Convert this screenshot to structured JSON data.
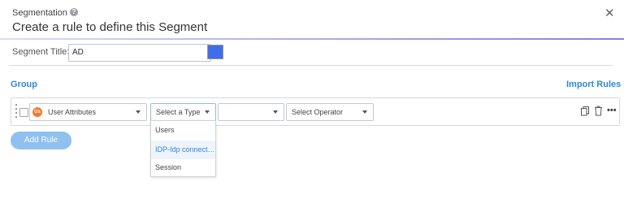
{
  "header": {
    "subtitle": "Segmentation",
    "title": "Create a rule to define this Segment",
    "close_glyph": "✕"
  },
  "segment": {
    "title_label": "Segment Title:",
    "title_value": "AD",
    "color": "#3f6ee8"
  },
  "group": {
    "label": "Group",
    "import_label": "Import Rules"
  },
  "rule": {
    "attribute_badge": "Ua",
    "attribute_select": "User Attributes",
    "type_select": "Select a Type",
    "value_select": "",
    "operator_select": "Select Operator"
  },
  "type_dropdown": {
    "options": [
      "Users",
      "IDP-Idp connecti...",
      "Session"
    ],
    "highlighted_index": 1
  },
  "actions": {
    "add_rule": "Add Rule",
    "more_glyph": "•••"
  },
  "colors": {
    "accent": "#2f87d8",
    "button": "#8fc0ef",
    "badge": "#f07a2a"
  }
}
